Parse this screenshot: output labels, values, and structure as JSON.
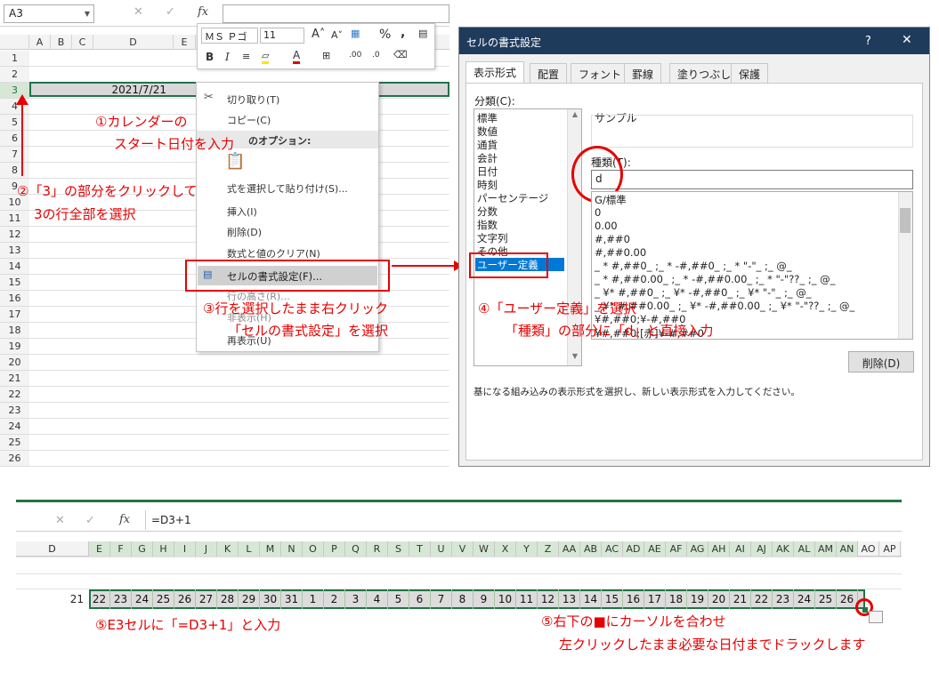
{
  "top_sheet": {
    "namebox": "A3",
    "fx": "fx",
    "columns": [
      "A",
      "B",
      "C",
      "D",
      "E"
    ],
    "rows": [
      "1",
      "2",
      "3",
      "4",
      "5",
      "6",
      "7",
      "8",
      "9",
      "10",
      "11",
      "12",
      "13",
      "14",
      "15",
      "16",
      "17",
      "18",
      "19",
      "20",
      "21",
      "22",
      "23",
      "24",
      "25",
      "26"
    ],
    "cell_d3": "2021/7/21"
  },
  "mini_toolbar": {
    "font": "ＭＳ Ｐゴ",
    "size": "11",
    "bold": "B",
    "italic": "I",
    "percent": "%",
    "comma": ","
  },
  "context_menu": {
    "items": [
      "切り取り(T)",
      "コピー(C)",
      "のオプション:",
      "式を選択して貼り付け(S)...",
      "挿入(I)",
      "削除(D)",
      "数式と値のクリア(N)",
      "セルの書式設定(F)...",
      "行の高さ(R)...",
      "非表示(H)",
      "再表示(U)"
    ]
  },
  "dialog": {
    "title": "セルの書式設定",
    "help": "?",
    "close": "✕",
    "tabs": [
      "表示形式",
      "配置",
      "フォント",
      "罫線",
      "塗りつぶし",
      "保護"
    ],
    "category_label": "分類(C):",
    "categories": [
      "標準",
      "数値",
      "通貨",
      "会計",
      "日付",
      "時刻",
      "パーセンテージ",
      "分数",
      "指数",
      "文字列",
      "その他",
      "ユーザー定義"
    ],
    "sample_label": "サンプル",
    "type_label": "種類(T):",
    "type_value": "d",
    "formats": [
      "G/標準",
      "0",
      "0.00",
      "#,##0",
      "#,##0.00",
      "_ * #,##0_ ;_ * -#,##0_ ;_ * \"-\"_ ;_ @_",
      "_ * #,##0.00_ ;_ * -#,##0.00_ ;_ * \"-\"??_ ;_ @_",
      "_ ¥* #,##0_ ;_ ¥* -#,##0_ ;_ ¥* \"-\"_ ;_ @_",
      "_ ¥* #,##0.00_ ;_ ¥* -#,##0.00_ ;_ ¥* \"-\"??_ ;_ @_",
      "¥#,##0;¥-#,##0",
      "¥#,##0;[赤]¥-#,##0"
    ],
    "delete_button": "削除(D)",
    "help_text": "基になる組み込みの表示形式を選択し、新しい表示形式を入力してください。"
  },
  "annotations": {
    "a1_line1": "①カレンダーの",
    "a1_line2": "スタート日付を入力",
    "a2_line1": "②「3」の部分をクリックして",
    "a2_line2": "3の行全部を選択",
    "a3_line1": "③行を選択したまま右クリック",
    "a3_line2": "「セルの書式設定」を選択",
    "a4_line1": "④「ユーザー定義」を選択",
    "a4_line2": "「種類」の部分に「d」と直接入力",
    "a5a": "⑤E3セルに「=D3+1」と入力",
    "a5b_line1": "⑤右下の■にカーソルを合わせ",
    "a5b_line2": "左クリックしたまま必要な日付までドラックします"
  },
  "bottom_sheet": {
    "formula": "=D3+1",
    "fx": "fx",
    "col_d": "D",
    "columns": [
      "E",
      "F",
      "G",
      "H",
      "I",
      "J",
      "K",
      "L",
      "M",
      "N",
      "O",
      "P",
      "Q",
      "R",
      "S",
      "T",
      "U",
      "V",
      "W",
      "X",
      "Y",
      "Z",
      "AA",
      "AB",
      "AC",
      "AD",
      "AE",
      "AF",
      "AG",
      "AH",
      "AI",
      "AJ",
      "AK",
      "AL",
      "AM",
      "AN",
      "AO",
      "AP"
    ],
    "d_value": "21",
    "days": [
      "22",
      "23",
      "24",
      "25",
      "26",
      "27",
      "28",
      "29",
      "30",
      "31",
      "1",
      "2",
      "3",
      "4",
      "5",
      "6",
      "7",
      "8",
      "9",
      "10",
      "11",
      "12",
      "13",
      "14",
      "15",
      "16",
      "17",
      "18",
      "19",
      "20",
      "21",
      "22",
      "23",
      "24",
      "25",
      "26"
    ]
  }
}
